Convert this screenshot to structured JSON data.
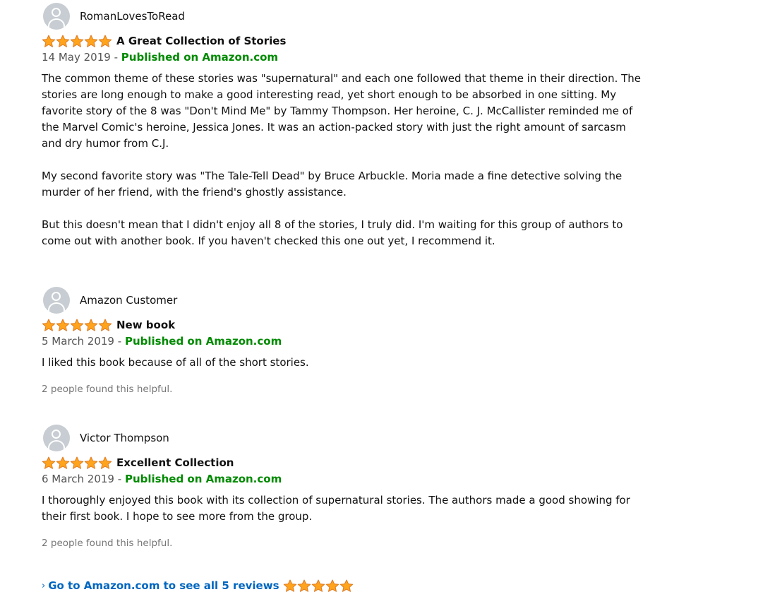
{
  "icons": {
    "avatar": "user-avatar-icon",
    "star": "star-icon",
    "chevron": "chevron-right-icon"
  },
  "colors": {
    "published": "#008a00",
    "link": "#0066c0",
    "star_fill": "#ffa41c"
  },
  "reviews": [
    {
      "author": "RomanLovesToRead",
      "rating": 5,
      "title": "A Great Collection of Stories",
      "date": "14 May 2019",
      "separator": "-",
      "published": "Published on Amazon.com",
      "paragraphs": [
        "The common theme of these stories was \"supernatural\" and each one followed that theme in their direction. The stories are long enough to make a good interesting read, yet short enough to be absorbed in one sitting. My favorite story of the 8 was \"Don't Mind Me\" by Tammy Thompson. Her heroine, C. J. McCallister reminded me of the Marvel Comic's heroine, Jessica Jones. It was an action-packed story with just the right amount of sarcasm and dry humor from C.J.",
        "My second favorite story was \"The Tale-Tell Dead\" by Bruce Arbuckle. Moria made a fine detective solving the murder of her friend, with the friend's ghostly assistance.",
        "But this doesn't mean that I didn't enjoy all 8 of the stories, I truly did. I'm waiting for this group of authors to come out with another book. If you haven't checked this one out yet, I recommend it."
      ],
      "helpful": ""
    },
    {
      "author": "Amazon Customer",
      "rating": 5,
      "title": "New book",
      "date": "5 March 2019",
      "separator": "-",
      "published": "Published on Amazon.com",
      "paragraphs": [
        "I liked this book because of all of the short stories."
      ],
      "helpful": "2 people found this helpful."
    },
    {
      "author": "Victor Thompson",
      "rating": 5,
      "title": "Excellent Collection",
      "date": "6 March 2019",
      "separator": "-",
      "published": "Published on Amazon.com",
      "paragraphs": [
        "I thoroughly enjoyed this book with its collection of supernatural stories. The authors made a good showing for their first book. I hope to see more from the group."
      ],
      "helpful": "2 people found this helpful."
    }
  ],
  "footer": {
    "chevron": "›",
    "see_all": "Go to Amazon.com to see all 5 reviews",
    "rating": 5
  }
}
